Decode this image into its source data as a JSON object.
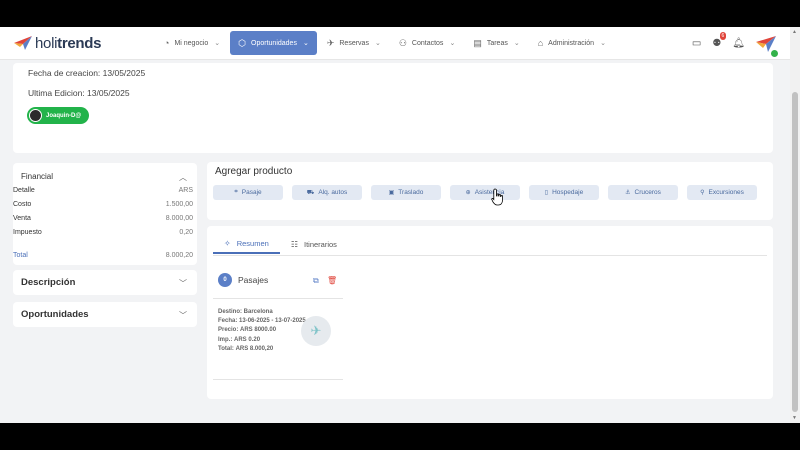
{
  "brand": {
    "name_light": "holi",
    "name_bold": "trends"
  },
  "nav": [
    {
      "label": "Mi negocio",
      "icon": "chart-pie-icon"
    },
    {
      "label": "Oportunidades",
      "icon": "cube-icon",
      "active": true
    },
    {
      "label": "Reservas",
      "icon": "plane-icon"
    },
    {
      "label": "Contactos",
      "icon": "users-icon"
    },
    {
      "label": "Tareas",
      "icon": "clipboard-icon"
    },
    {
      "label": "Administración",
      "icon": "bank-icon"
    }
  ],
  "top_icons": {
    "notifications_count": "6"
  },
  "info": {
    "created": "Fecha de creacion: 13/05/2025",
    "edited": "Ultima Edicion: 13/05/2025",
    "user": "Joaquin-D@"
  },
  "financial": {
    "title": "Financial",
    "rows": [
      {
        "label": "Detalle",
        "value": "ARS"
      },
      {
        "label": "Costo",
        "value": "1.500,00"
      },
      {
        "label": "Venta",
        "value": "8.000,00"
      },
      {
        "label": "Impuesto",
        "value": "0,20"
      }
    ],
    "total_label": "Total",
    "total_value": "8.000,20"
  },
  "panels": {
    "description": "Descripción",
    "opportunities": "Oportunidades"
  },
  "add_product": {
    "title": "Agregar producto",
    "buttons": [
      "Pasaje",
      "Alq. autos",
      "Traslado",
      "Asistencia",
      "Hospedaje",
      "Cruceros",
      "Excursiones"
    ]
  },
  "tabs": [
    "Resumen",
    "Itinerarios"
  ],
  "pasajes": {
    "count": "0",
    "title": "Pasajes",
    "lines": [
      {
        "label": "Destino:",
        "value": "Barcelona"
      },
      {
        "label": "Fecha:",
        "value": "13-06-2025 - 13-07-2025"
      },
      {
        "label": "Precio:",
        "value": "ARS 8000.00"
      },
      {
        "label": "Imp.:",
        "value": "ARS 0.20"
      },
      {
        "label": "Total:",
        "value": "ARS 8.000,20"
      }
    ]
  },
  "colors": {
    "accent": "#5b7fc7",
    "success": "#22b34a",
    "danger": "#e0443a"
  }
}
